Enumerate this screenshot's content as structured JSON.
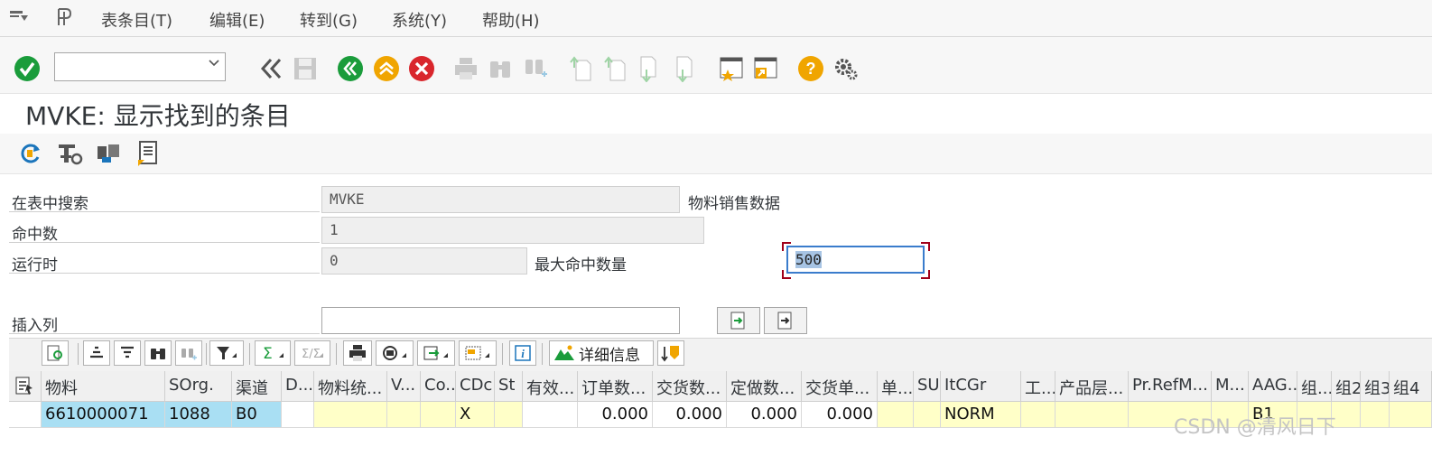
{
  "menu": {
    "items": [
      "表条目(T)",
      "编辑(E)",
      "转到(G)",
      "系统(Y)",
      "帮助(H)"
    ]
  },
  "toolbar": {
    "command_value": "",
    "icons": [
      "enter-check-icon",
      "back-chevrons-icon",
      "save-icon",
      "back-icon",
      "exit-up-icon",
      "cancel-icon",
      "print-icon",
      "find-icon",
      "find-next-icon",
      "first-page-icon",
      "prev-page-icon",
      "next-page-icon",
      "last-page-icon",
      "create-session-icon",
      "shortcut-icon",
      "help-icon",
      "settings-icon"
    ]
  },
  "title": "MVKE: 显示找到的条目",
  "form": {
    "search_in_table_label": "在表中搜索",
    "table_value": "MVKE",
    "table_desc": "物料销售数据",
    "hits_label": "命中数",
    "hits_value": "1",
    "runtime_label": "运行时",
    "runtime_value": "0",
    "max_hits_label": "最大命中数量",
    "max_hits_value": "500",
    "insert_col_label": "插入列",
    "insert_col_value": ""
  },
  "alv": {
    "details_label": "详细信息"
  },
  "grid": {
    "headers": [
      "物料",
      "SOrg.",
      "渠道",
      "D...",
      "物料统...",
      "V...",
      "Co...",
      "CDc",
      "St",
      "有效...",
      "订单数...",
      "交货数...",
      "定做数...",
      "交货单...",
      "单...",
      "SU",
      "ItCGr",
      "工...",
      "产品层...",
      "Pr.RefM...",
      "M...",
      "AAG...",
      "组...",
      "组2",
      "组3",
      "组4"
    ],
    "row": [
      "6610000071",
      "1088",
      "B0",
      "",
      "",
      "",
      "",
      "X",
      "",
      "",
      "0.000",
      "0.000",
      "0.000",
      "0.000",
      "",
      "",
      "NORM",
      "",
      "",
      "",
      "",
      "B1",
      "",
      "",
      "",
      ""
    ]
  },
  "watermark": "CSDN @清风日下",
  "colors": {
    "accent_green": "#1a9c3b",
    "accent_orange": "#f0a500",
    "accent_red": "#d9262c",
    "key_cell": "#a9dff3",
    "editable_cell": "#ffffc8"
  }
}
